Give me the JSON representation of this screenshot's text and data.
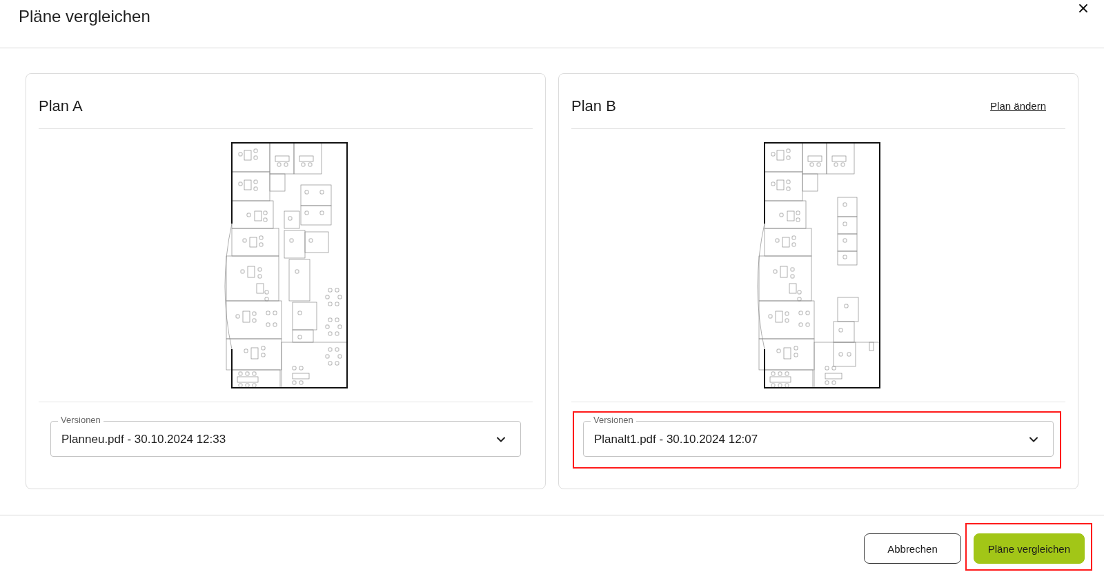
{
  "dialog": {
    "title": "Pläne vergleichen"
  },
  "plans": [
    {
      "title": "Plan A",
      "versions": {
        "label": "Versionen",
        "value": "Planneu.pdf - 30.10.2024 12:33",
        "highlighted": false
      }
    },
    {
      "title": "Plan B",
      "change_link": "Plan ändern",
      "versions": {
        "label": "Versionen",
        "value": "Planalt1.pdf - 30.10.2024 12:07",
        "highlighted": true
      }
    }
  ],
  "footer": {
    "buttons": [
      {
        "label": "Abbrechen",
        "kind": "secondary",
        "highlighted": false
      },
      {
        "label": "Pläne vergleichen",
        "kind": "primary",
        "highlighted": true
      }
    ]
  }
}
